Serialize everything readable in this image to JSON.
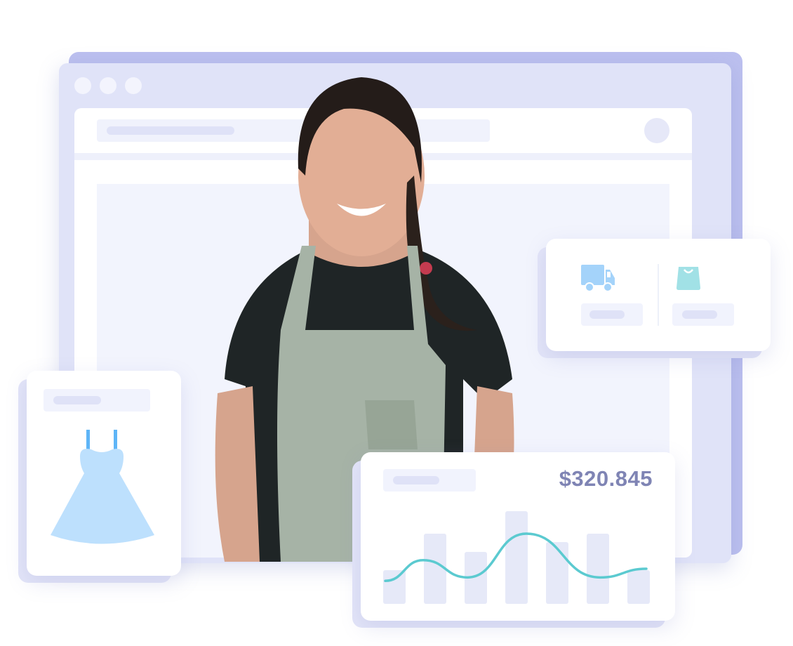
{
  "revenue_card": {
    "amount": "$320.845",
    "chart_data": {
      "type": "bar",
      "bar_values": [
        48,
        100,
        74,
        132,
        88,
        100,
        48
      ],
      "line_values": [
        18,
        54,
        24,
        100,
        24,
        39
      ],
      "bar_color": "#e6e9f8",
      "line_color": "#5bcad0"
    }
  },
  "delivery_card": {
    "icons": [
      "truck-icon",
      "shopping-bag-icon"
    ],
    "truck_color": "#a4d3fa",
    "bag_color": "#a1e1e6"
  },
  "product_card": {
    "icon": "dress-icon",
    "dress_color": "#bde0fd",
    "strap_color": "#5eb5f7"
  },
  "colors": {
    "window_back": "#bcc0ef",
    "window": "#e0e3f8",
    "accent_text": "#7f84b4"
  }
}
